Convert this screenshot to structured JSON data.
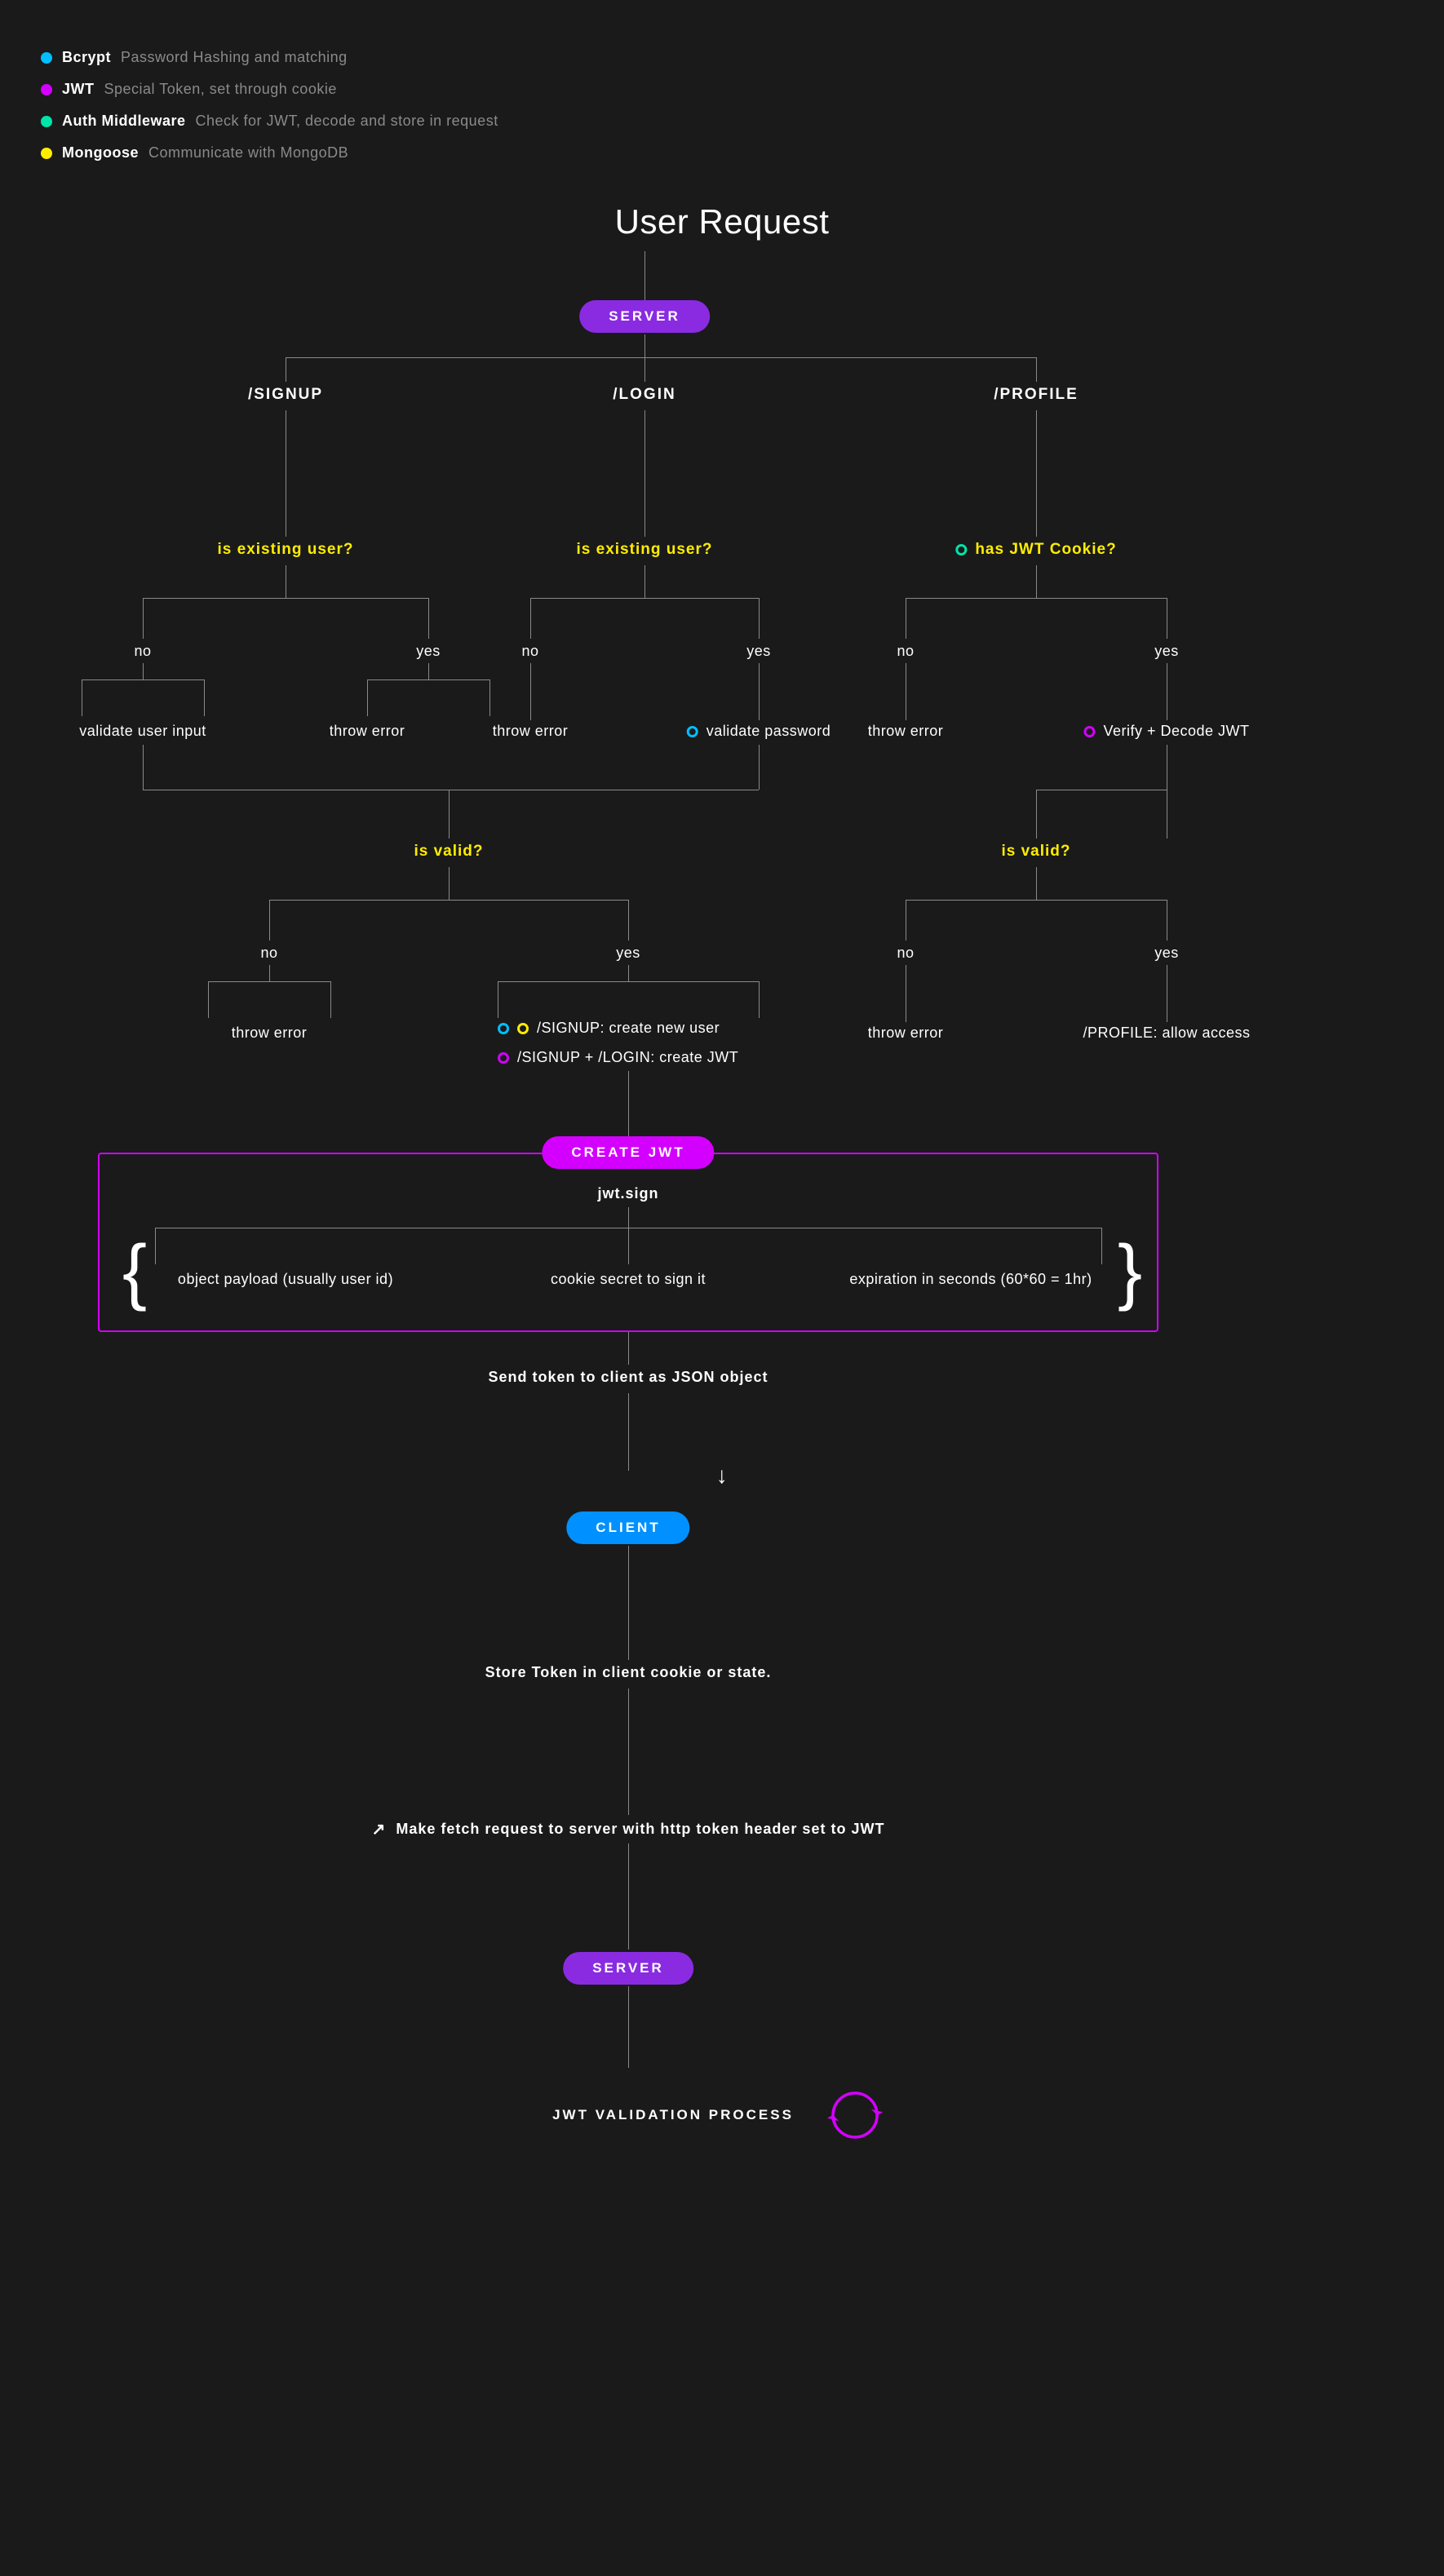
{
  "legend": [
    {
      "color": "cyan",
      "name": "Bcrypt",
      "desc": "Password Hashing and matching"
    },
    {
      "color": "magenta",
      "name": "JWT",
      "desc": "Special Token, set through cookie"
    },
    {
      "color": "teal",
      "name": "Auth Middleware",
      "desc": "Check for JWT, decode and store in request"
    },
    {
      "color": "yellow",
      "name": "Mongoose",
      "desc": "Communicate with MongoDB"
    }
  ],
  "title": "User Request",
  "pills": {
    "server1": "SERVER",
    "createjwt": "CREATE JWT",
    "client": "CLIENT",
    "server2": "SERVER"
  },
  "routes": {
    "signup": "/SIGNUP",
    "login": "/LOGIN",
    "profile": "/PROFILE"
  },
  "questions": {
    "existing1": "is existing user?",
    "existing2": "is existing user?",
    "hasjwt": "has JWT Cookie?",
    "valid1": "is valid?",
    "valid2": "is valid?"
  },
  "answers": {
    "no": "no",
    "yes": "yes"
  },
  "actions": {
    "validateinput": "validate user input",
    "throwerror": "throw error",
    "validatepw": "validate password",
    "verifyjwt": "Verify + Decode JWT",
    "signupcreate": "/SIGNUP: create new user",
    "logincreate": "/SIGNUP + /LOGIN: create JWT",
    "profileallow": "/PROFILE: allow access"
  },
  "jwtbox": {
    "sign": "jwt.sign",
    "payload": "object payload (usually user id)",
    "secret": "cookie secret to sign it",
    "expiration": "expiration in seconds (60*60 = 1hr)"
  },
  "steps": {
    "send": "Send token to client as JSON object",
    "store": "Store Token in client cookie or state.",
    "fetch": "Make fetch request to server with http token header set to JWT"
  },
  "cycle": "JWT VALIDATION PROCESS"
}
